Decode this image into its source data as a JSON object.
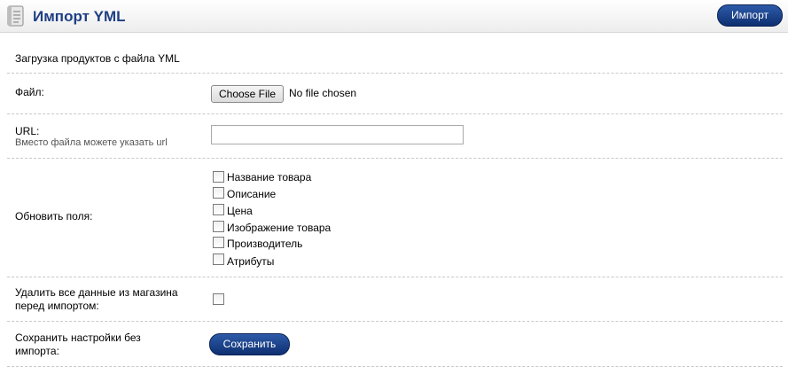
{
  "header": {
    "title": "Импорт YML",
    "import_button": "Импорт"
  },
  "intro": "Загрузка продуктов с файла YML",
  "file": {
    "label": "Файл:",
    "choose_button": "Choose File",
    "status": "No file chosen"
  },
  "url": {
    "label": "URL:",
    "hint": "Вместо файла можете указать url",
    "value": ""
  },
  "update_fields": {
    "label": "Обновить поля:",
    "options": [
      {
        "label": "Название товара",
        "checked": false
      },
      {
        "label": "Описание",
        "checked": false
      },
      {
        "label": "Цена",
        "checked": false
      },
      {
        "label": "Изображение товара",
        "checked": false
      },
      {
        "label": "Производитель",
        "checked": false
      },
      {
        "label": "Атрибуты",
        "checked": false
      }
    ]
  },
  "delete_all": {
    "label_line1": "Удалить все данные из магазина",
    "label_line2": "перед импортом:",
    "checked": false
  },
  "save_settings": {
    "label_line1": "Сохранить настройки без",
    "label_line2": "импорта:",
    "button": "Сохранить"
  }
}
